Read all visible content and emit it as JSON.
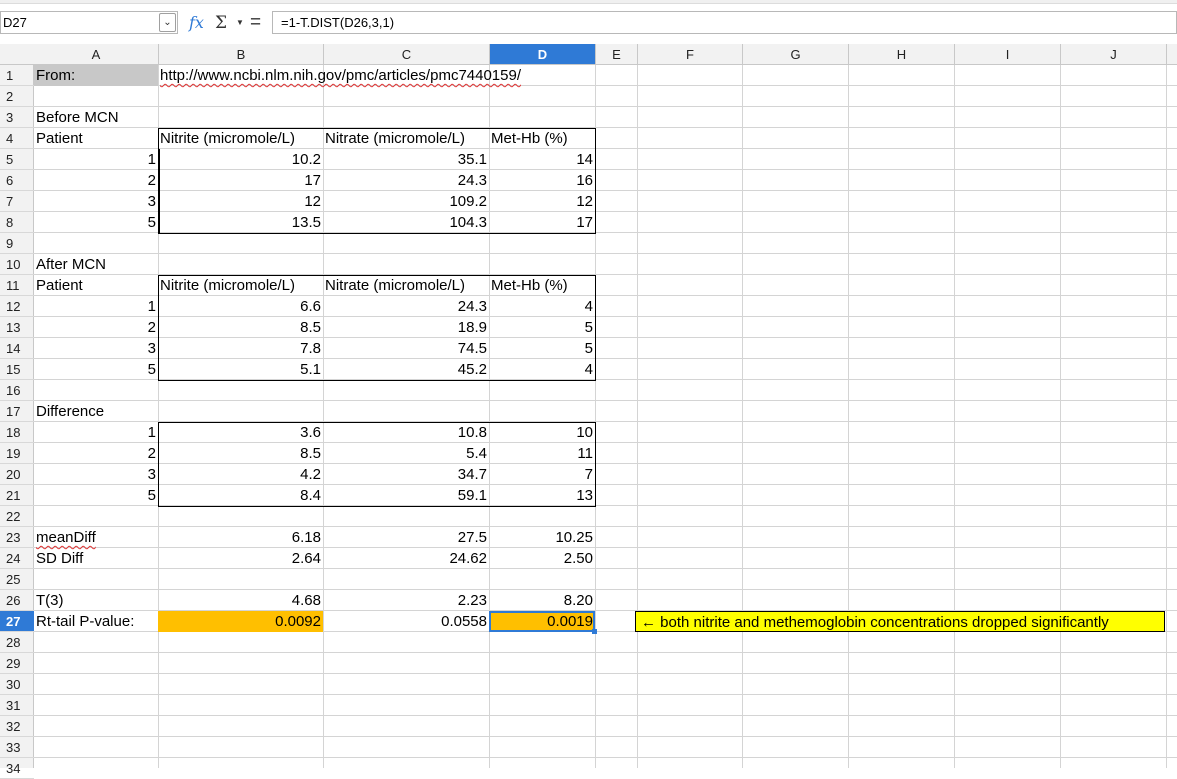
{
  "formula_bar": {
    "cell_ref": "D27",
    "formula": "=1-T.DIST(D26,3,1)"
  },
  "icons": {
    "name_box_dropdown": "chevron-down-icon",
    "function_wizard": "fx-icon",
    "sum": "sum-icon",
    "formula": "equals-icon"
  },
  "colors": {
    "selection": "#2f7ad6",
    "highlight_orange": "#ffbf00",
    "highlight_yellow": "#ffff00",
    "label_gray": "#c8c8c8"
  },
  "columns": [
    "A",
    "B",
    "C",
    "D",
    "E",
    "F",
    "G",
    "H",
    "I",
    "J"
  ],
  "active_column": "D",
  "rows": [
    "1",
    "2",
    "3",
    "4",
    "5",
    "6",
    "7",
    "8",
    "9",
    "10",
    "11",
    "12",
    "13",
    "14",
    "15",
    "16",
    "17",
    "18",
    "19",
    "20",
    "21",
    "22",
    "23",
    "24",
    "25",
    "26",
    "27",
    "28",
    "29",
    "30",
    "31",
    "32",
    "33",
    "34"
  ],
  "active_row": "27",
  "cells": {
    "A1": "From:",
    "B1": "http://www.ncbi.nlm.nih.gov/pmc/articles/pmc7440159/",
    "A3": "Before MCN",
    "A4": "Patient",
    "B4": "Nitrite (micromole/L)",
    "C4": "Nitrate (micromole/L)",
    "D4": "Met-Hb (%)",
    "A5": "1",
    "B5": "10.2",
    "C5": "35.1",
    "D5": "14",
    "A6": "2",
    "B6": "17",
    "C6": "24.3",
    "D6": "16",
    "A7": "3",
    "B7": "12",
    "C7": "109.2",
    "D7": "12",
    "A8": "5",
    "B8": "13.5",
    "C8": "104.3",
    "D8": "17",
    "A10": "After MCN",
    "A11": "Patient",
    "B11": "Nitrite (micromole/L)",
    "C11": "Nitrate (micromole/L)",
    "D11": "Met-Hb (%)",
    "A12": "1",
    "B12": "6.6",
    "C12": "24.3",
    "D12": "4",
    "A13": "2",
    "B13": "8.5",
    "C13": "18.9",
    "D13": "5",
    "A14": "3",
    "B14": "7.8",
    "C14": "74.5",
    "D14": "5",
    "A15": "5",
    "B15": "5.1",
    "C15": "45.2",
    "D15": "4",
    "A17": "Difference",
    "A18": "1",
    "B18": "3.6",
    "C18": "10.8",
    "D18": "10",
    "A19": "2",
    "B19": "8.5",
    "C19": "5.4",
    "D19": "11",
    "A20": "3",
    "B20": "4.2",
    "C20": "34.7",
    "D20": "7",
    "A21": "5",
    "B21": "8.4",
    "C21": "59.1",
    "D21": "13",
    "A23": "meanDiff",
    "B23": "6.18",
    "C23": "27.5",
    "D23": "10.25",
    "A24": "SD Diff",
    "B24": "2.64",
    "C24": "24.62",
    "D24": "2.50",
    "A26": "T(3)",
    "B26": "4.68",
    "C26": "2.23",
    "D26": "8.20",
    "A27": "Rt-tail P-value:",
    "B27": "0.0092",
    "C27": "0.0558",
    "D27": "0.0019",
    "F27": "← both nitrite and methemoglobin concentrations dropped significantly"
  }
}
